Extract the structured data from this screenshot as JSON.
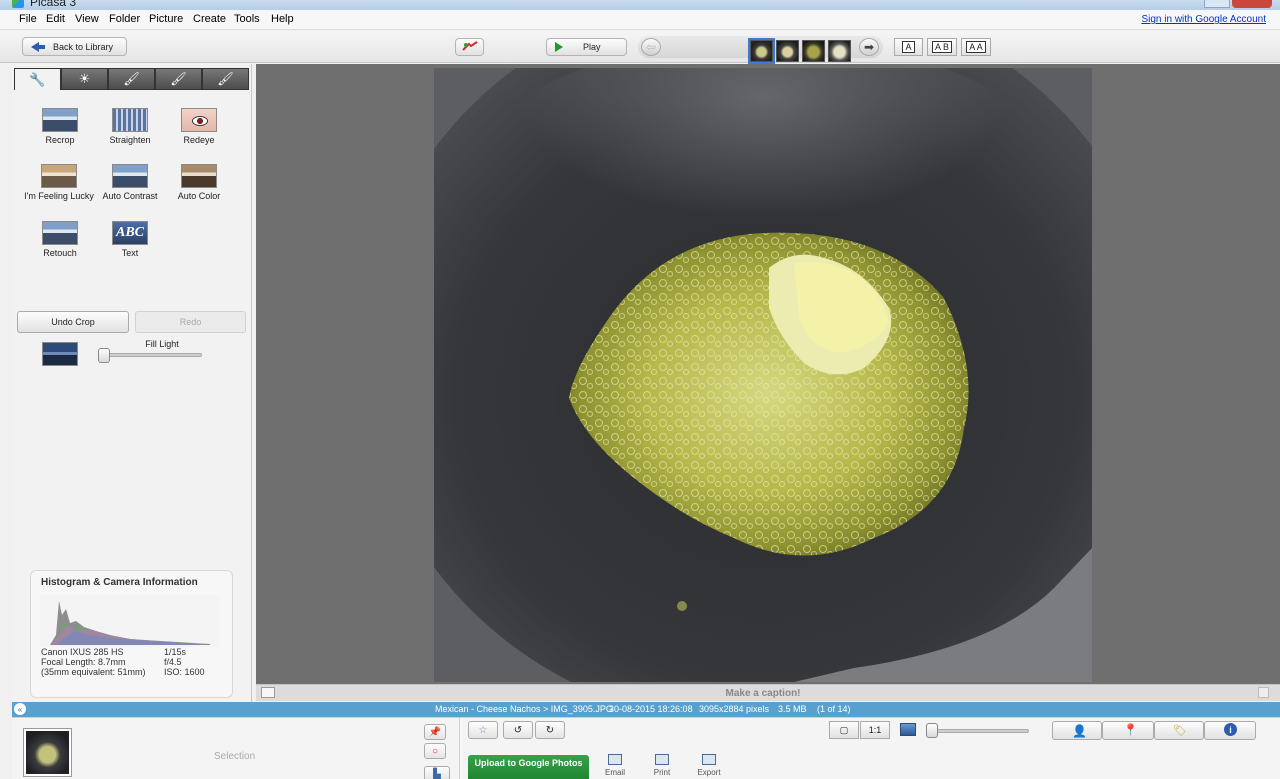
{
  "window": {
    "title": "Picasa 3"
  },
  "menu": {
    "items": [
      "File",
      "Edit",
      "View",
      "Folder",
      "Picture",
      "Create",
      "Tools",
      "Help"
    ],
    "sign_in": "Sign in with Google Account"
  },
  "toolbar": {
    "back_label": "Back to Library",
    "play_label": "Play",
    "text_sizes": [
      "A",
      "A B",
      "A A"
    ]
  },
  "edit_panel": {
    "tabs": [
      "wrench-icon",
      "sun-icon",
      "brush-icon",
      "brush-photo-icon",
      "brush-photo-blue-icon"
    ],
    "tools": [
      "Recrop",
      "Straighten",
      "Redeye",
      "I'm Feeling Lucky",
      "Auto Contrast",
      "Auto Color",
      "Retouch",
      "Text"
    ],
    "text_icon_label": "ABC",
    "fill_light_label": "Fill Light",
    "fill_light_level": 0,
    "undo_label": "Undo Crop",
    "redo_label": "Redo"
  },
  "histogram": {
    "title": "Histogram & Camera Information",
    "camera": "Canon IXUS 285 HS",
    "focal_length": "Focal Length: 8.7mm",
    "equivalent": "(35mm equivalent:  51mm)",
    "shutter": "1/15s",
    "aperture": "f/4.5",
    "iso": "ISO: 1600"
  },
  "caption": {
    "placeholder": "Make a caption!"
  },
  "info_bar": {
    "path": "Mexican - Cheese Nachos > IMG_3905.JPG",
    "date": "30-08-2015 18:26:08",
    "dimensions": "3095x2884 pixels",
    "size": "3.5 MB",
    "position": "(1 of 14)"
  },
  "tray": {
    "selection_label": "Selection",
    "upload_label": "Upload to Google Photos",
    "actions": [
      "Email",
      "Print",
      "Export"
    ],
    "view_labels": [
      "1:1"
    ]
  }
}
